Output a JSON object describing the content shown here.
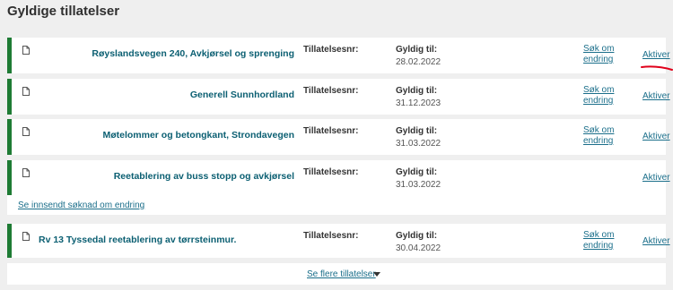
{
  "page": {
    "title": "Gyldige tillatelser"
  },
  "labels": {
    "permit_nr": "Tillatelsesnr:",
    "valid_to": "Gyldig til:",
    "request_change": "Søk om endring",
    "activate": "Aktiver",
    "submitted_change": "Se innsendt søknad om endring",
    "show_more": "Se flere tillatelser"
  },
  "permits": [
    {
      "title": "Røyslandsvegen 240, Avkjørsel og sprenging",
      "valid_date": "28.02.2022"
    },
    {
      "title": "Generell Sunnhordland",
      "valid_date": "31.12.2023"
    },
    {
      "title": "Møtelommer og betongkant, Strondavegen",
      "valid_date": "31.03.2022"
    },
    {
      "title": "Reetablering av buss stopp og avkjørsel",
      "valid_date": "31.03.2022"
    },
    {
      "title": "Rv 13 Tyssedal reetablering av tørrsteinmur.",
      "valid_date": "30.04.2022"
    }
  ],
  "icons": {
    "document": "document-icon",
    "expand": "caret-down-icon"
  },
  "colors": {
    "accent_border": "#1e7b34",
    "title": "#0b5f72",
    "link": "#1a6e8a",
    "annotation": "#e0001a"
  }
}
